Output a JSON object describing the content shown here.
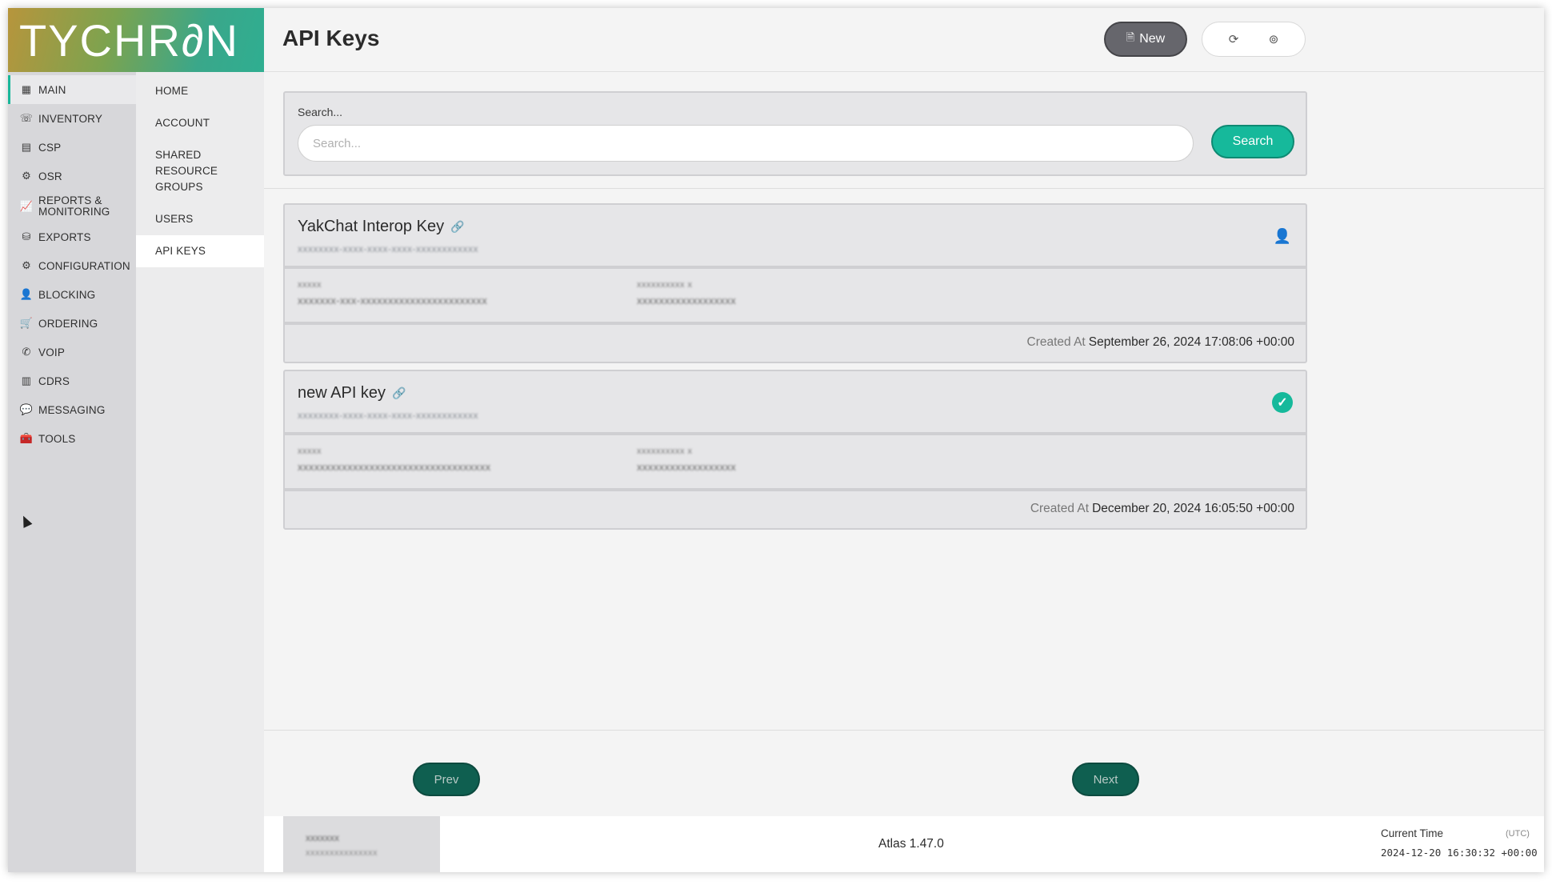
{
  "brand": {
    "logo_text": "TYCHR∂N"
  },
  "sidebar": {
    "items": [
      {
        "label": "MAIN",
        "icon": "building-icon"
      },
      {
        "label": "INVENTORY",
        "icon": "phone-list-icon"
      },
      {
        "label": "CSP",
        "icon": "card-icon"
      },
      {
        "label": "OSR",
        "icon": "gear-square-icon"
      },
      {
        "label": "REPORTS & MONITORING",
        "icon": "chart-line-icon"
      },
      {
        "label": "EXPORTS",
        "icon": "coins-icon"
      },
      {
        "label": "CONFIGURATION",
        "icon": "config-icon"
      },
      {
        "label": "BLOCKING",
        "icon": "user-block-icon"
      },
      {
        "label": "ORDERING",
        "icon": "basket-icon"
      },
      {
        "label": "VOIP",
        "icon": "phone-icon"
      },
      {
        "label": "CDRS",
        "icon": "table-icon"
      },
      {
        "label": "MESSAGING",
        "icon": "chat-icon"
      },
      {
        "label": "TOOLS",
        "icon": "toolbox-icon"
      }
    ],
    "subitems": [
      {
        "label": "HOME"
      },
      {
        "label": "ACCOUNT"
      },
      {
        "label": "SHARED RESOURCE GROUPS"
      },
      {
        "label": "USERS"
      },
      {
        "label": "API KEYS"
      }
    ]
  },
  "header": {
    "title": "API Keys",
    "new_label": "New"
  },
  "search": {
    "label": "Search...",
    "placeholder": "Search...",
    "value": "",
    "button_label": "Search"
  },
  "keys": [
    {
      "name": "YakChat Interop Key",
      "id": "xxxxxxxx-xxxx-xxxx-xxxx-xxxxxxxxxxxx",
      "field1_label": "xxxxx",
      "field1_value": "xxxxxxx-xxx-xxxxxxxxxxxxxxxxxxxxxxx",
      "field2_label": "xxxxxxxxxx x",
      "field2_value": "xxxxxxxxxxxxxxxxxx",
      "created_label": "Created At",
      "created_value": "September 26, 2024 17:08:06 +00:00",
      "status_icon": "user-check-icon"
    },
    {
      "name": "new API key",
      "id": "xxxxxxxx-xxxx-xxxx-xxxx-xxxxxxxxxxxx",
      "field1_label": "xxxxx",
      "field1_value": "xxxxxxxxxxxxxxxxxxxxxxxxxxxxxxxxxxx",
      "field2_label": "xxxxxxxxxx x",
      "field2_value": "xxxxxxxxxxxxxxxxxx",
      "created_label": "Created At",
      "created_value": "December 20, 2024 16:05:50 +00:00",
      "status_icon": "check-circle-icon"
    }
  ],
  "pagination": {
    "prev_label": "Prev",
    "next_label": "Next"
  },
  "footer": {
    "user_line1": "xxxxxxx",
    "user_line2": "xxxxxxxxxxxxxxx",
    "version": "Atlas 1.47.0",
    "time_label": "Current Time",
    "timezone": "(UTC)",
    "time_value": "2024-12-20 16:30:32 +00:00"
  },
  "colors": {
    "accent": "#16b99b",
    "dark_button": "#0f5f50",
    "new_button": "#66666c"
  }
}
